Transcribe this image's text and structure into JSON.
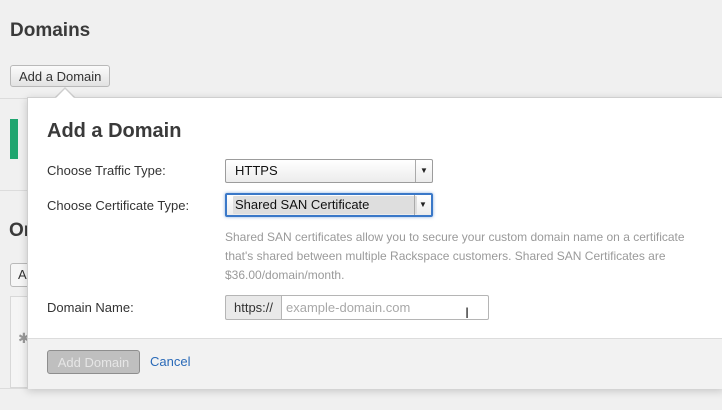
{
  "page": {
    "title": "Domains",
    "add_domain_label": "Add a Domain",
    "partial_heading": "Or",
    "partial_button": "A"
  },
  "modal": {
    "title": "Add a Domain",
    "traffic_type": {
      "label": "Choose Traffic Type:",
      "value": "HTTPS"
    },
    "certificate_type": {
      "label": "Choose Certificate Type:",
      "value": "Shared SAN Certificate"
    },
    "help_text": "Shared SAN certificates allow you to secure your custom domain name on a certificate that's shared between multiple Rackspace customers. Shared SAN Certificates are $36.00/domain/month.",
    "domain_name": {
      "label": "Domain Name:",
      "prefix": "https://",
      "placeholder": "example-domain.com",
      "value": ""
    },
    "submit_label": "Add Domain",
    "cancel_label": "Cancel"
  },
  "icons": {
    "dropdown": "chevron-down-icon",
    "gear": "gear-icon",
    "text_cursor": "text-cursor-icon"
  },
  "colors": {
    "accent_green": "#1fa56f",
    "focus_blue": "#3a78c8",
    "link_blue": "#2a6ab8"
  }
}
